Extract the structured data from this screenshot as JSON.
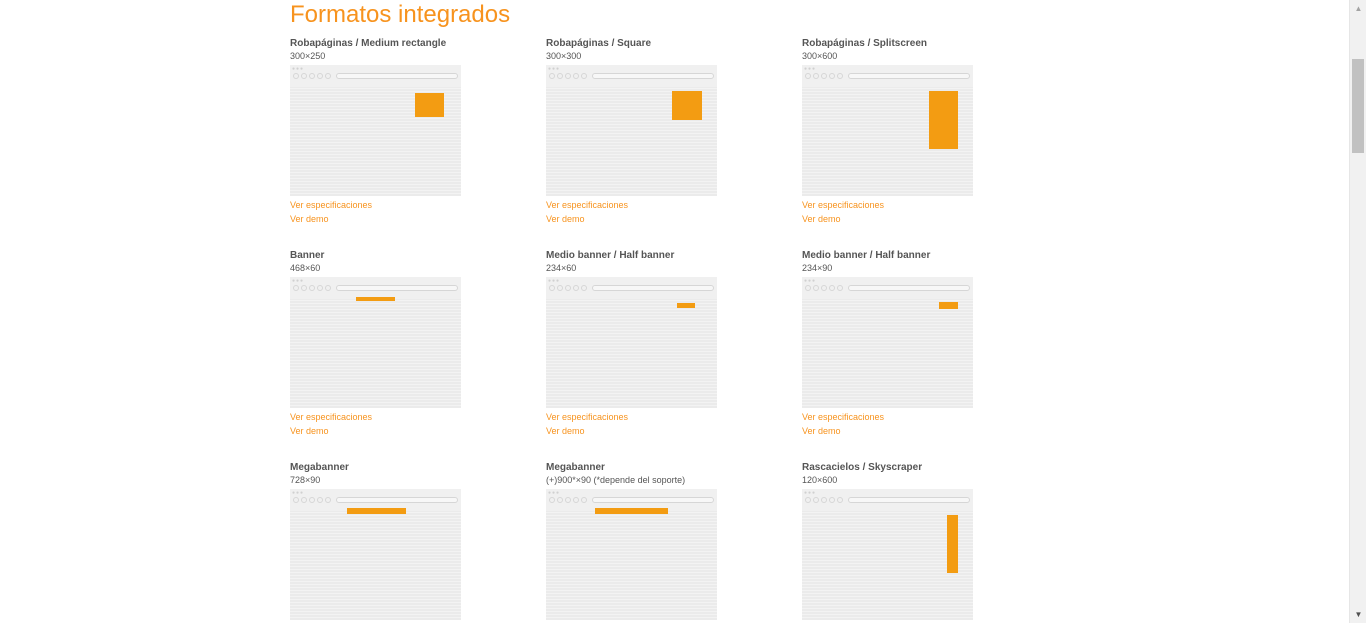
{
  "page": {
    "title": "Formatos integrados"
  },
  "links": {
    "specs": "Ver especificaciones",
    "demo": "Ver demo"
  },
  "colors": {
    "accent": "#f7931e",
    "ad_block": "#f39c12"
  },
  "cards": [
    {
      "title": "Robapáginas / Medium rectangle",
      "size": "300×250"
    },
    {
      "title": "Robapáginas / Square",
      "size": "300×300"
    },
    {
      "title": "Robapáginas / Splitscreen",
      "size": "300×600"
    },
    {
      "title": "Banner",
      "size": "468×60"
    },
    {
      "title": "Medio banner / Half banner",
      "size": "234×60"
    },
    {
      "title": "Medio banner / Half banner",
      "size": "234×90"
    },
    {
      "title": "Megabanner",
      "size": "728×90"
    },
    {
      "title": "Megabanner",
      "size": "(+)900*×90 (*depende del soporte)"
    },
    {
      "title": "Rascacielos / Skyscraper",
      "size": "120×600"
    }
  ],
  "scrollbar": {
    "up_icon": "▲",
    "down_icon": "▼"
  }
}
